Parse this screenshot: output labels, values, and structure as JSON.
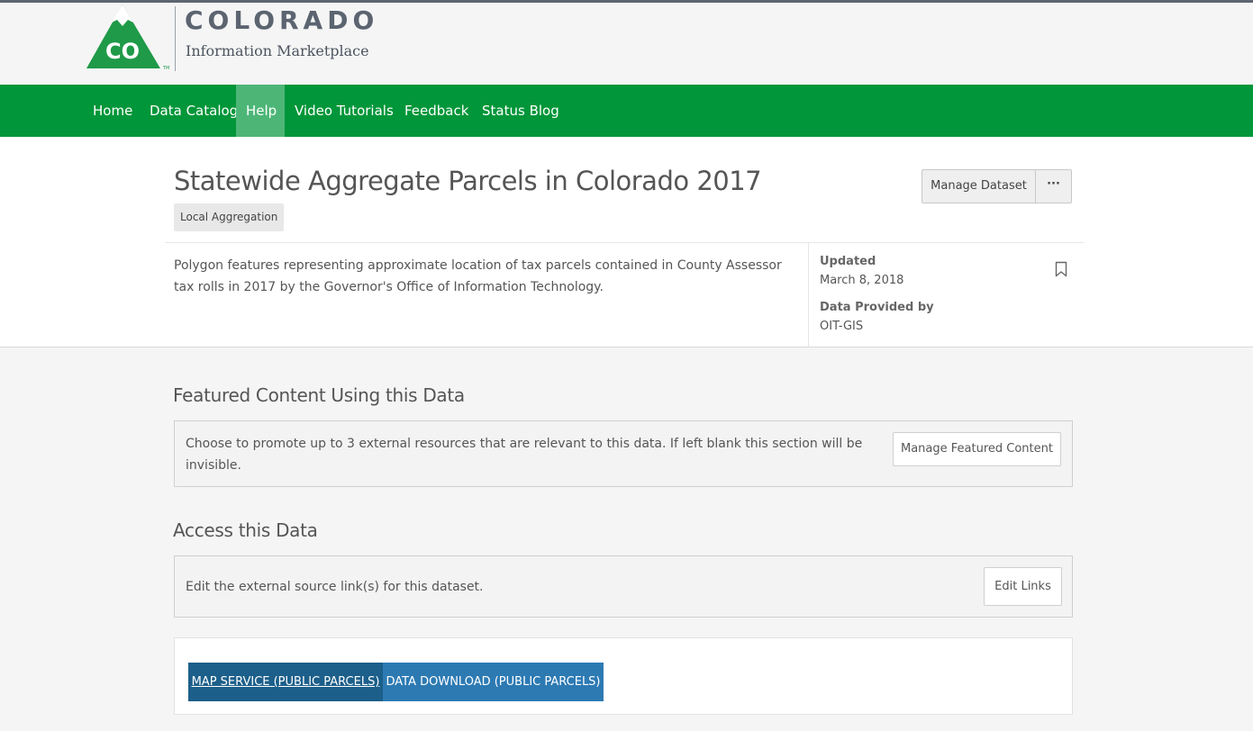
{
  "brand": {
    "logo_initials": "CO",
    "trademark": "TM",
    "title": "COLORADO",
    "subtitle": "Information Marketplace"
  },
  "nav": {
    "items": [
      {
        "label": "Home",
        "active": false
      },
      {
        "label": "Data Catalog",
        "active": false
      },
      {
        "label": "Help",
        "active": true
      },
      {
        "label": "Video Tutorials",
        "active": false
      },
      {
        "label": "Feedback",
        "active": false
      },
      {
        "label": "Status Blog",
        "active": false
      }
    ]
  },
  "dataset": {
    "title": "Statewide Aggregate Parcels in Colorado 2017",
    "tag": "Local Aggregation",
    "manage_label": "Manage Dataset",
    "more_label": "···",
    "description": "Polygon features representing approximate location of tax parcels contained in County Assessor tax rolls in 2017 by the Governor's Office of Information Technology.",
    "updated_label": "Updated",
    "updated_value": "March 8, 2018",
    "provider_label": "Data Provided by",
    "provider_value": "OIT-GIS",
    "bookmark_icon": "bookmark-icon"
  },
  "featured": {
    "heading": "Featured Content Using this Data",
    "text": "Choose to promote up to 3 external resources that are relevant to this data. If left blank this section will be invisible.",
    "button_label": "Manage Featured Content"
  },
  "access": {
    "heading": "Access this Data",
    "text": "Edit the external source link(s) for this dataset.",
    "button_label": "Edit Links",
    "links": [
      {
        "label": "MAP SERVICE (PUBLIC PARCELS)"
      },
      {
        "label": "DATA DOWNLOAD (PUBLIC PARCELS)"
      }
    ]
  },
  "colors": {
    "nav_green": "#009639",
    "nav_active": "#4db677",
    "link_dark_blue": "#1c5f8a",
    "link_blue": "#2d7ab3"
  }
}
